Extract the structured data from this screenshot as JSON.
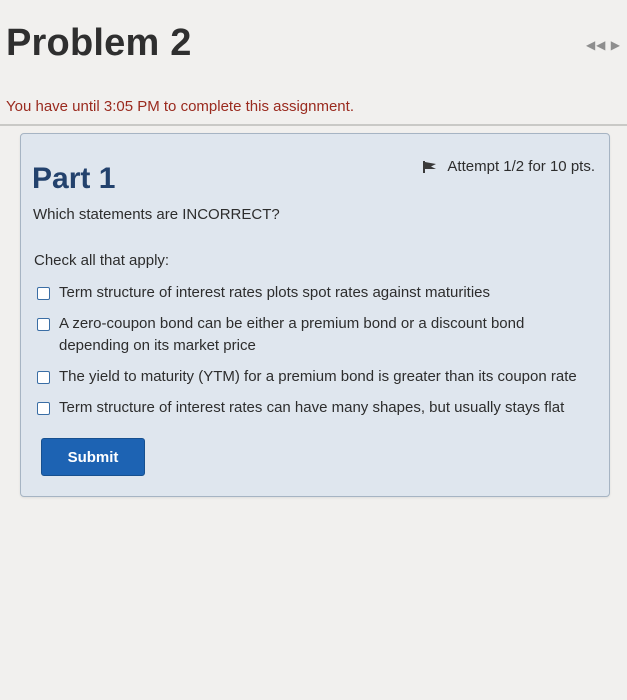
{
  "header": {
    "title": "Problem 2",
    "nav_prev": "◀◀",
    "nav_next": "▶"
  },
  "deadline_text": "You have until 3:05 PM to complete this assignment.",
  "part": {
    "title": "Part 1",
    "attempt": "Attempt 1/2 for 10 pts.",
    "question": "Which statements are INCORRECT?",
    "instructions": "Check all that apply:",
    "options": [
      {
        "label": "Term structure of interest rates plots spot rates against maturities",
        "checked": false
      },
      {
        "label": "A zero-coupon bond can be either a premium bond or a discount bond depending on its market price",
        "checked": false
      },
      {
        "label": "The yield to maturity (YTM) for a premium bond is greater than its coupon rate",
        "checked": false
      },
      {
        "label": "Term structure of interest rates can have many shapes, but usually stays flat",
        "checked": false
      }
    ],
    "submit_label": "Submit"
  },
  "colors": {
    "part_title": "#23426d",
    "deadline": "#9a2a1e",
    "submit_bg": "#1d63b3",
    "card_bg": "#dfe6ee"
  },
  "icons": {
    "attempt_flag": "flag-icon",
    "checkbox": "checkbox-icon"
  }
}
